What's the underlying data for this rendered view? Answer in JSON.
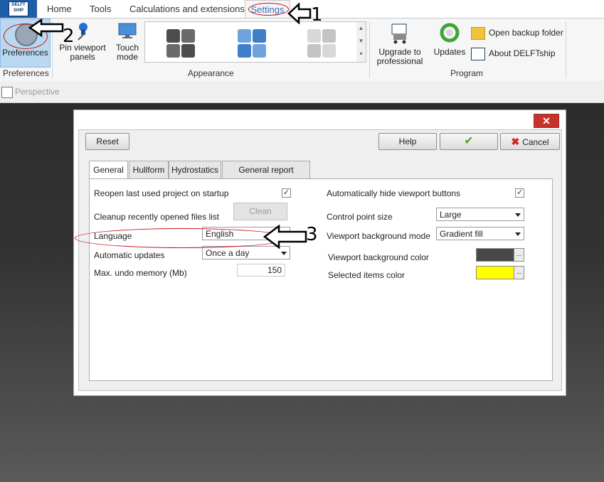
{
  "tabs": [
    "Home",
    "Tools",
    "Calculations and extensions",
    "Settings"
  ],
  "ribbon": {
    "preferences": "Preferences",
    "pin_viewport_panels": "Pin viewport\npanels",
    "pin_line1": "Pin viewport",
    "pin_line2": "panels",
    "touch_line1": "Touch",
    "touch_line2": "mode",
    "upgrade_line1": "Upgrade to",
    "upgrade_line2": "professional",
    "updates": "Updates",
    "open_backup_folder": "Open backup folder",
    "about": "About DELFTship",
    "group_preferences": "Preferences",
    "group_appearance": "Appearance",
    "group_program": "Program"
  },
  "perspective": "Perspective",
  "dialog": {
    "reset": "Reset",
    "help": "Help",
    "ok": "✔",
    "cancel": "Cancel",
    "close": "✕",
    "tabs": [
      "General",
      "Hullform",
      "Hydrostatics",
      "General report settings"
    ],
    "left": {
      "reopen": "Reopen last used project on startup",
      "reopen_checked": "✓",
      "cleanup": "Cleanup recently opened files list",
      "clean_btn": "Clean",
      "language_label": "Language",
      "language_value": "English",
      "auto_updates_label": "Automatic updates",
      "auto_updates_value": "Once a day",
      "undo_label": "Max. undo memory (Mb)",
      "undo_value": "150"
    },
    "right": {
      "auto_hide": "Automatically hide viewport buttons",
      "auto_hide_checked": "✓",
      "cp_size_label": "Control point size",
      "cp_size_value": "Large",
      "bg_mode_label": "Viewport background mode",
      "bg_mode_value": "Gradient fill",
      "bg_color_label": "Viewport background color",
      "bg_color": "#484848",
      "sel_color_label": "Selected items color",
      "sel_color": "#ffff00",
      "dots": "..."
    }
  },
  "annotations": {
    "n1": "1",
    "n2": "2",
    "n3": "3"
  },
  "colors": {
    "accent": "#1d5ea8",
    "annotation_ring": "#c8141b",
    "close": "#c8322d"
  }
}
